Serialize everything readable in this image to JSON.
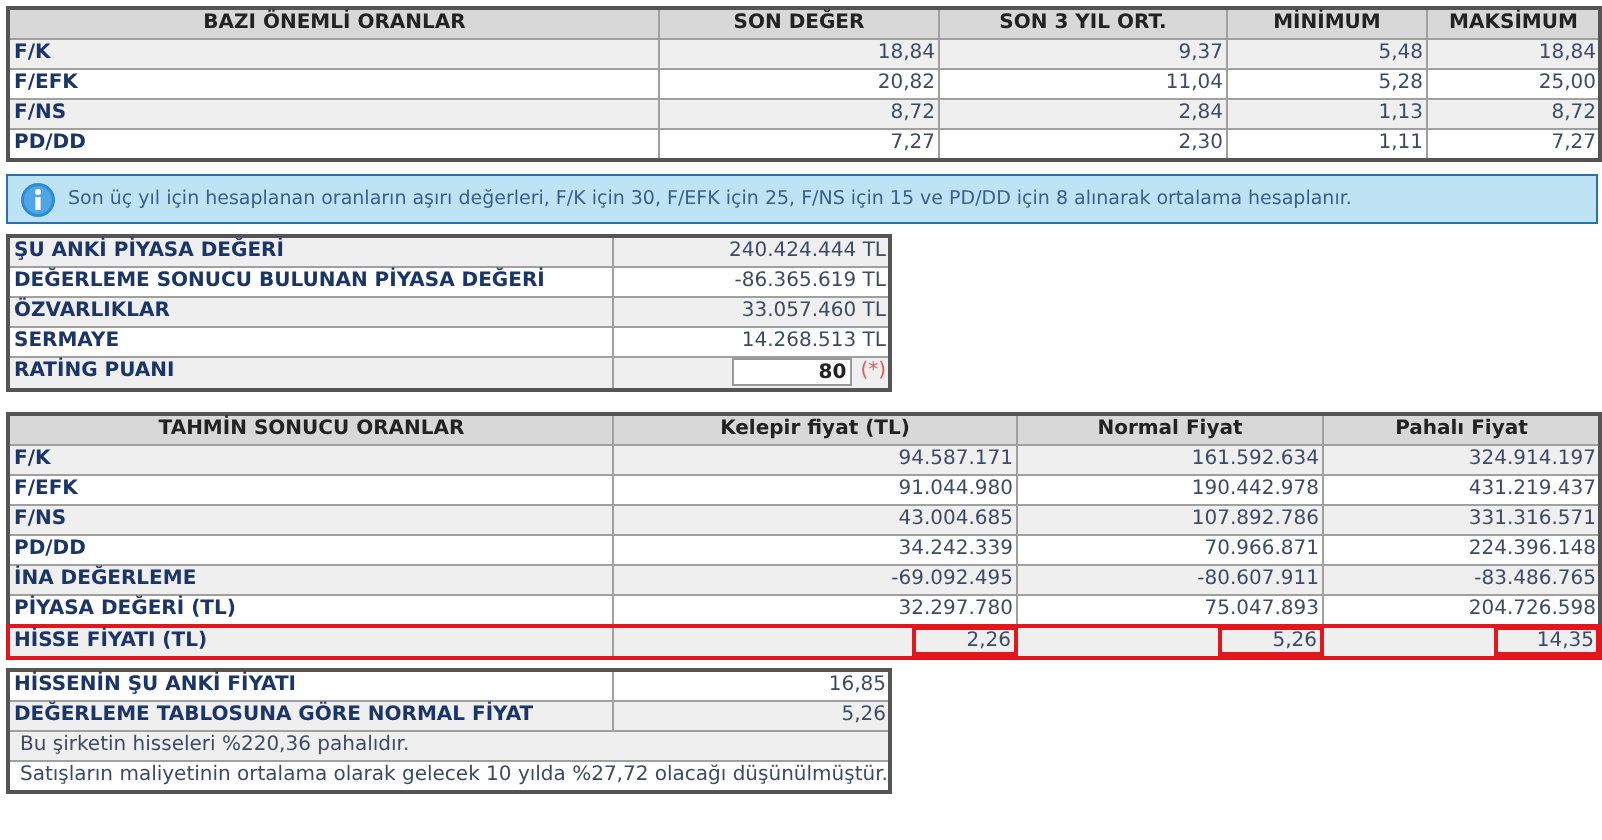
{
  "ratios": {
    "columns": [
      "BAZI ÖNEMLİ ORANLAR",
      "SON DEĞER",
      "SON 3 YIL ORT.",
      "MİNİMUM",
      "MAKSİMUM"
    ],
    "rows": [
      {
        "label": "F/K",
        "values": [
          "18,84",
          "9,37",
          "5,48",
          "18,84"
        ]
      },
      {
        "label": "F/EFK",
        "values": [
          "20,82",
          "11,04",
          "5,28",
          "25,00"
        ]
      },
      {
        "label": "F/NS",
        "values": [
          "8,72",
          "2,84",
          "1,13",
          "8,72"
        ]
      },
      {
        "label": "PD/DD",
        "values": [
          "7,27",
          "2,30",
          "1,11",
          "7,27"
        ]
      }
    ]
  },
  "info_note": "Son üç yıl için hesaplanan oranların aşırı değerleri, F/K için 30, F/EFK için 25, F/NS için 15 ve PD/DD için 8 alınarak ortalama hesaplanır.",
  "valuation": {
    "rows": [
      {
        "kind": "text",
        "label": "ŞU ANKİ PİYASA DEĞERİ",
        "value": "240.424.444 TL"
      },
      {
        "kind": "text",
        "label": "DEĞERLEME SONUCU BULUNAN PİYASA DEĞERİ",
        "value": "-86.365.619 TL"
      },
      {
        "kind": "text",
        "label": "ÖZVARLIKLAR",
        "value": "33.057.460 TL"
      },
      {
        "kind": "text",
        "label": "SERMAYE",
        "value": "14.268.513 TL"
      },
      {
        "kind": "input",
        "label": "RATİNG PUANI",
        "value": "80",
        "note": "(*)"
      }
    ]
  },
  "estimates": {
    "columns": [
      "TAHMİN SONUCU ORANLAR",
      "Kelepir fiyat (TL)",
      "Normal Fiyat",
      "Pahalı Fiyat"
    ],
    "rows": [
      {
        "label": "F/K",
        "values": [
          "94.587.171",
          "161.592.634",
          "324.914.197"
        ],
        "highlighted": false
      },
      {
        "label": "F/EFK",
        "values": [
          "91.044.980",
          "190.442.978",
          "431.219.437"
        ],
        "highlighted": false
      },
      {
        "label": "F/NS",
        "values": [
          "43.004.685",
          "107.892.786",
          "331.316.571"
        ],
        "highlighted": false
      },
      {
        "label": "PD/DD",
        "values": [
          "34.242.339",
          "70.966.871",
          "224.396.148"
        ],
        "highlighted": false
      },
      {
        "label": "İNA DEĞERLEME",
        "values": [
          "-69.092.495",
          "-80.607.911",
          "-83.486.765"
        ],
        "highlighted": false
      },
      {
        "label": "PİYASA DEĞERİ (TL)",
        "values": [
          "32.297.780",
          "75.047.893",
          "204.726.598"
        ],
        "highlighted": false
      },
      {
        "label": "HİSSE FİYATI (TL)",
        "values": [
          "2,26",
          "5,26",
          "14,35"
        ],
        "highlighted": true
      }
    ]
  },
  "price_summary": {
    "rows": [
      {
        "label": "HİSSENİN ŞU ANKİ FİYATI",
        "value": "16,85"
      },
      {
        "label": "DEĞERLEME TABLOSUNA GÖRE NORMAL FİYAT",
        "value": "5,26"
      }
    ],
    "notes": [
      "Bu şirketin hisseleri %220,36 pahalıdır.",
      "Satışların maliyetinin ortalama olarak gelecek 10 yılda %27,72 olacağı düşünülmüştür."
    ]
  }
}
